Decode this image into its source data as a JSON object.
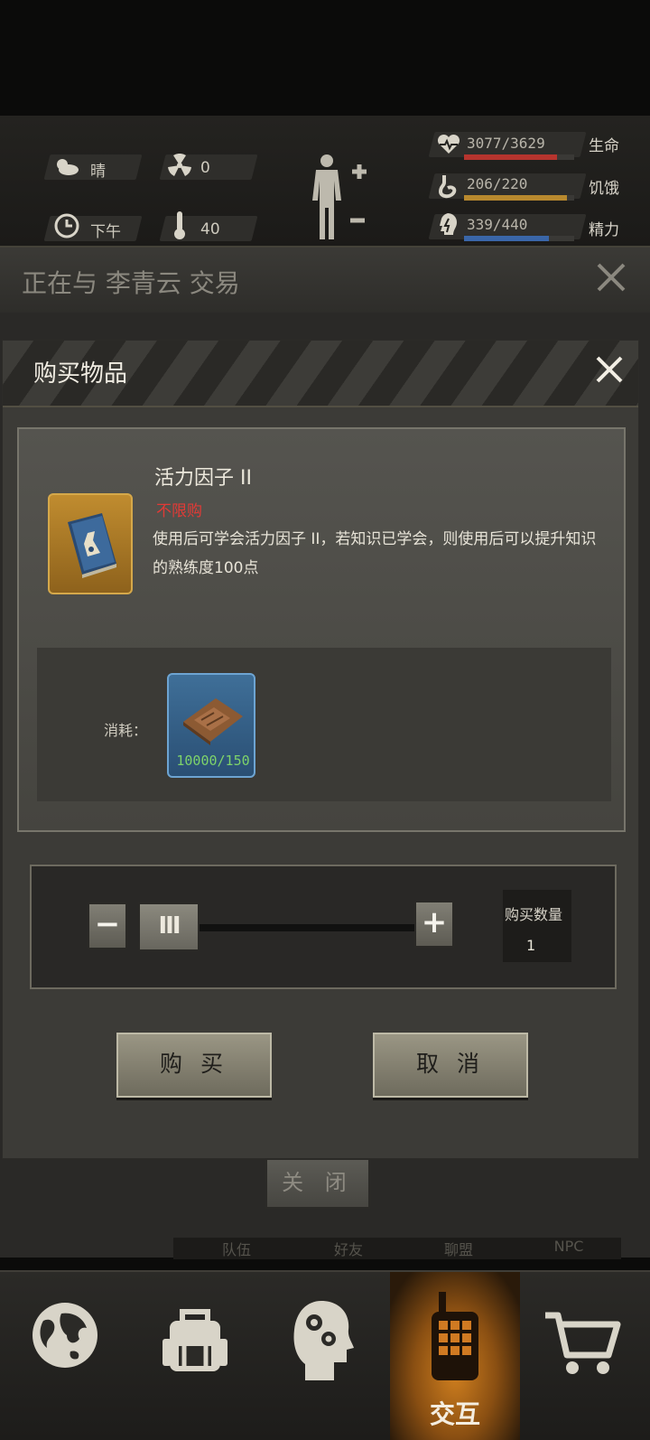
{
  "status": {
    "weather": "晴",
    "radiation": "0",
    "time_of_day": "下午",
    "temperature": "40",
    "stats": [
      {
        "name": "生命",
        "value": "3077/3629",
        "fraction": 0.848,
        "color": "#b6342e"
      },
      {
        "name": "饥饿",
        "value": "206/220",
        "fraction": 0.936,
        "color": "#b8892e"
      },
      {
        "name": "精力",
        "value": "339/440",
        "fraction": 0.77,
        "color": "#3a66a8"
      }
    ]
  },
  "trade": {
    "title": "正在与 李青云 交易",
    "close_label": "关 闭"
  },
  "buy_dialog": {
    "title": "购买物品",
    "item_name": "活力因子 II",
    "limit_tag": "不限购",
    "description": "使用后可学会活力因子 II，若知识已学会，则使用后可以提升知识的熟练度100点",
    "cost_label": "消耗：",
    "cost_count": "10000/150",
    "qty_label": "购买数量",
    "qty_value": "1",
    "qty_fraction": 0.0,
    "buy_label": "购 买",
    "cancel_label": "取 消"
  },
  "subtabs": [
    "队伍",
    "好友",
    "聊盟",
    "NPC"
  ],
  "nav": {
    "items": [
      {
        "icon": "globe-icon"
      },
      {
        "icon": "backpack-icon"
      },
      {
        "icon": "head-gears-icon"
      },
      {
        "icon": "radio-icon",
        "label": "交互"
      },
      {
        "icon": "cart-icon"
      }
    ]
  }
}
